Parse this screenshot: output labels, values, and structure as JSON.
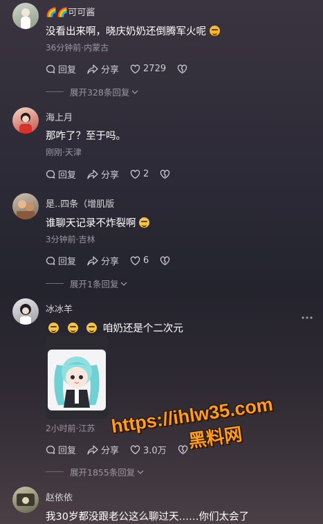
{
  "actions": {
    "reply": "回复",
    "share": "分享"
  },
  "comments": [
    {
      "user": "🌈🌈可可酱",
      "text": "没看出来啊，晓庆奶奶还倒腾军火呢",
      "meta": "36分钟前·内蒙古",
      "likes": "2729",
      "expand": "展开328条回复"
    },
    {
      "user": "海上月",
      "text": "那咋了？至于吗。",
      "meta": "刚刚·天津",
      "likes": "2"
    },
    {
      "user": "是..四条（增肌版",
      "text": "谁聊天记录不炸裂啊",
      "meta": "3分钟前·吉林",
      "likes": "6",
      "expand": "展开1条回复"
    },
    {
      "user": "冰冰羊",
      "text": "咱奶还是个二次元",
      "meta": "2小时前·江苏",
      "likes": "3.0万",
      "expand": "展开1855条回复"
    },
    {
      "user": "赵依依",
      "text": "我30岁都没跟老公这么聊过天……你们太会了"
    }
  ],
  "watermark": {
    "line1": "https://ihlw35.com",
    "line2": "黑料网"
  },
  "icons": {
    "reply": "comment-icon",
    "share": "share-arrow-icon",
    "like": "heart-icon",
    "dislike": "broken-heart-icon",
    "more": "more-dots-icon"
  },
  "colors": {
    "watermark": "#ff9d1c"
  }
}
